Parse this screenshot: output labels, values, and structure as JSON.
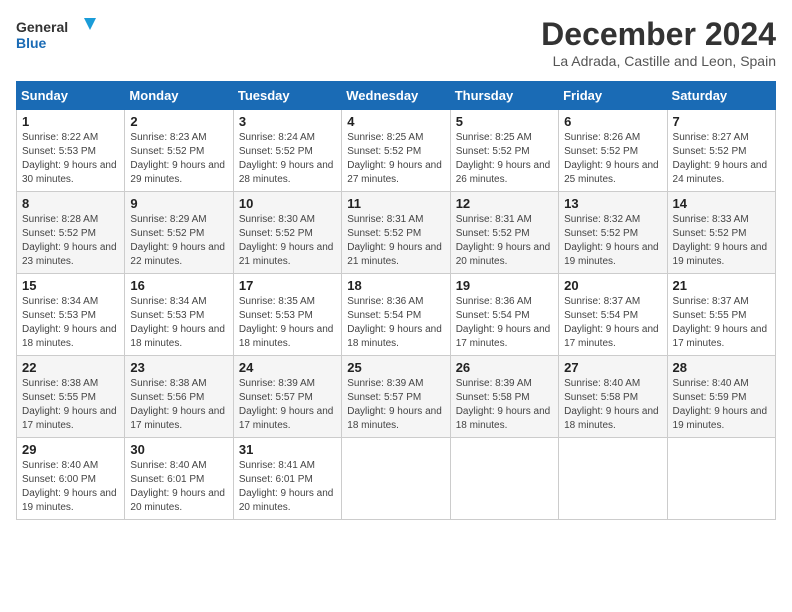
{
  "logo": {
    "line1": "General",
    "line2": "Blue"
  },
  "title": "December 2024",
  "location": "La Adrada, Castille and Leon, Spain",
  "days_of_week": [
    "Sunday",
    "Monday",
    "Tuesday",
    "Wednesday",
    "Thursday",
    "Friday",
    "Saturday"
  ],
  "weeks": [
    [
      {
        "day": "1",
        "sunrise": "8:22 AM",
        "sunset": "5:53 PM",
        "daylight": "9 hours and 30 minutes."
      },
      {
        "day": "2",
        "sunrise": "8:23 AM",
        "sunset": "5:52 PM",
        "daylight": "9 hours and 29 minutes."
      },
      {
        "day": "3",
        "sunrise": "8:24 AM",
        "sunset": "5:52 PM",
        "daylight": "9 hours and 28 minutes."
      },
      {
        "day": "4",
        "sunrise": "8:25 AM",
        "sunset": "5:52 PM",
        "daylight": "9 hours and 27 minutes."
      },
      {
        "day": "5",
        "sunrise": "8:25 AM",
        "sunset": "5:52 PM",
        "daylight": "9 hours and 26 minutes."
      },
      {
        "day": "6",
        "sunrise": "8:26 AM",
        "sunset": "5:52 PM",
        "daylight": "9 hours and 25 minutes."
      },
      {
        "day": "7",
        "sunrise": "8:27 AM",
        "sunset": "5:52 PM",
        "daylight": "9 hours and 24 minutes."
      }
    ],
    [
      {
        "day": "8",
        "sunrise": "8:28 AM",
        "sunset": "5:52 PM",
        "daylight": "9 hours and 23 minutes."
      },
      {
        "day": "9",
        "sunrise": "8:29 AM",
        "sunset": "5:52 PM",
        "daylight": "9 hours and 22 minutes."
      },
      {
        "day": "10",
        "sunrise": "8:30 AM",
        "sunset": "5:52 PM",
        "daylight": "9 hours and 21 minutes."
      },
      {
        "day": "11",
        "sunrise": "8:31 AM",
        "sunset": "5:52 PM",
        "daylight": "9 hours and 21 minutes."
      },
      {
        "day": "12",
        "sunrise": "8:31 AM",
        "sunset": "5:52 PM",
        "daylight": "9 hours and 20 minutes."
      },
      {
        "day": "13",
        "sunrise": "8:32 AM",
        "sunset": "5:52 PM",
        "daylight": "9 hours and 19 minutes."
      },
      {
        "day": "14",
        "sunrise": "8:33 AM",
        "sunset": "5:52 PM",
        "daylight": "9 hours and 19 minutes."
      }
    ],
    [
      {
        "day": "15",
        "sunrise": "8:34 AM",
        "sunset": "5:53 PM",
        "daylight": "9 hours and 18 minutes."
      },
      {
        "day": "16",
        "sunrise": "8:34 AM",
        "sunset": "5:53 PM",
        "daylight": "9 hours and 18 minutes."
      },
      {
        "day": "17",
        "sunrise": "8:35 AM",
        "sunset": "5:53 PM",
        "daylight": "9 hours and 18 minutes."
      },
      {
        "day": "18",
        "sunrise": "8:36 AM",
        "sunset": "5:54 PM",
        "daylight": "9 hours and 18 minutes."
      },
      {
        "day": "19",
        "sunrise": "8:36 AM",
        "sunset": "5:54 PM",
        "daylight": "9 hours and 17 minutes."
      },
      {
        "day": "20",
        "sunrise": "8:37 AM",
        "sunset": "5:54 PM",
        "daylight": "9 hours and 17 minutes."
      },
      {
        "day": "21",
        "sunrise": "8:37 AM",
        "sunset": "5:55 PM",
        "daylight": "9 hours and 17 minutes."
      }
    ],
    [
      {
        "day": "22",
        "sunrise": "8:38 AM",
        "sunset": "5:55 PM",
        "daylight": "9 hours and 17 minutes."
      },
      {
        "day": "23",
        "sunrise": "8:38 AM",
        "sunset": "5:56 PM",
        "daylight": "9 hours and 17 minutes."
      },
      {
        "day": "24",
        "sunrise": "8:39 AM",
        "sunset": "5:57 PM",
        "daylight": "9 hours and 17 minutes."
      },
      {
        "day": "25",
        "sunrise": "8:39 AM",
        "sunset": "5:57 PM",
        "daylight": "9 hours and 18 minutes."
      },
      {
        "day": "26",
        "sunrise": "8:39 AM",
        "sunset": "5:58 PM",
        "daylight": "9 hours and 18 minutes."
      },
      {
        "day": "27",
        "sunrise": "8:40 AM",
        "sunset": "5:58 PM",
        "daylight": "9 hours and 18 minutes."
      },
      {
        "day": "28",
        "sunrise": "8:40 AM",
        "sunset": "5:59 PM",
        "daylight": "9 hours and 19 minutes."
      }
    ],
    [
      {
        "day": "29",
        "sunrise": "8:40 AM",
        "sunset": "6:00 PM",
        "daylight": "9 hours and 19 minutes."
      },
      {
        "day": "30",
        "sunrise": "8:40 AM",
        "sunset": "6:01 PM",
        "daylight": "9 hours and 20 minutes."
      },
      {
        "day": "31",
        "sunrise": "8:41 AM",
        "sunset": "6:01 PM",
        "daylight": "9 hours and 20 minutes."
      },
      null,
      null,
      null,
      null
    ]
  ]
}
